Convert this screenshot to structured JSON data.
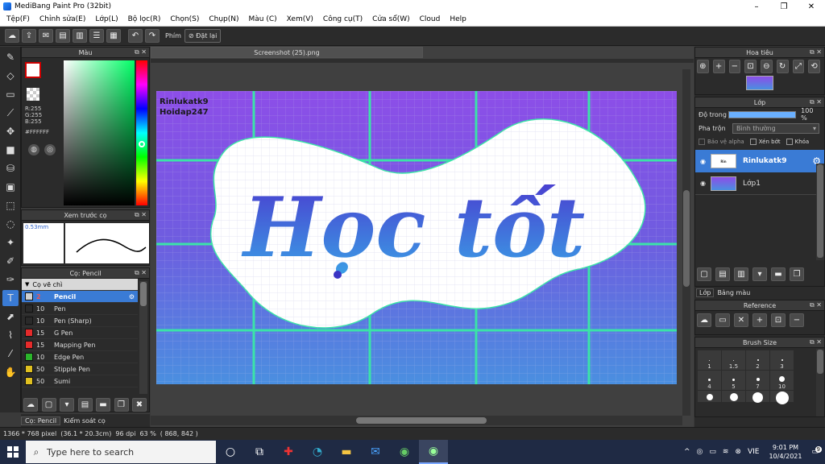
{
  "window": {
    "title": "MediBang Paint Pro (32bit)",
    "minimize": "–",
    "maximize": "❐",
    "close": "✕"
  },
  "menu": [
    "Tệp(F)",
    "Chỉnh sửa(E)",
    "Lớp(L)",
    "Bộ lọc(R)",
    "Chọn(S)",
    "Chụp(N)",
    "Màu (C)",
    "Xem(V)",
    "Công cụ(T)",
    "Cửa sổ(W)",
    "Cloud",
    "Help"
  ],
  "toolbar": {
    "finger_label": "Phím",
    "reset_label": "Đặt lại"
  },
  "color_panel": {
    "title": "Màu",
    "r": "R:255",
    "g": "G:255",
    "b": "B:255",
    "hex": "#FFFFFF"
  },
  "brush_preview": {
    "title": "Xem trước cọ",
    "size": "0.53mm"
  },
  "brush_panel": {
    "title": "Cọ: Pencil",
    "group": "Cọ vẽ chì",
    "items": [
      {
        "size": "2",
        "name": "Pencil",
        "color": "#cfcfcf",
        "selected": true
      },
      {
        "size": "10",
        "name": "Pen",
        "color": "#2a2a2a"
      },
      {
        "size": "10",
        "name": "Pen (Sharp)",
        "color": "#2a2a2a"
      },
      {
        "size": "15",
        "name": "G Pen",
        "color": "#e52b2b"
      },
      {
        "size": "15",
        "name": "Mapping Pen",
        "color": "#e52b2b"
      },
      {
        "size": "10",
        "name": "Edge Pen",
        "color": "#2bb52b"
      },
      {
        "size": "50",
        "name": "Stipple Pen",
        "color": "#e0c020"
      },
      {
        "size": "50",
        "name": "Sumi",
        "color": "#e0c020"
      }
    ]
  },
  "bottom_tabs": [
    "Cọ: Pencil",
    "Kiểm soát cọ"
  ],
  "document": {
    "tab": "Screenshot (25).png",
    "watermark_line1": "Rinlukatk9",
    "watermark_line2": "Hoidap247",
    "art_text": "Học tốt"
  },
  "navigator": {
    "title": "Hoa tiêu"
  },
  "layer_panel": {
    "title": "Lớp",
    "opacity_label": "Độ trong",
    "opacity_value": "100 %",
    "opacity": 1.0,
    "blend_label": "Pha trộn",
    "blend_value": "Bình thường",
    "protect_alpha": "Bảo vệ alpha",
    "clip": "Xén bớt",
    "lock": "Khóa",
    "layers": [
      {
        "name": "Rinlukatk9",
        "selected": true
      },
      {
        "name": "Lớp1",
        "selected": false
      }
    ],
    "tabs": [
      "Lớp",
      "Bảng màu"
    ]
  },
  "reference": {
    "title": "Reference"
  },
  "brush_size": {
    "title": "Brush Size",
    "sizes": [
      "1",
      "1.5",
      "2",
      "3",
      "4",
      "5",
      "7",
      "10"
    ]
  },
  "status": {
    "pixels": "1366 * 768 pixel",
    "cm": "(36.1 * 20.3cm)",
    "dpi": "96 dpi",
    "zoom": "63 %",
    "coords": "( 868, 842 )"
  },
  "taskbar": {
    "search_placeholder": "Type here to search",
    "lang": "VIE",
    "time": "9:01 PM",
    "date": "10/4/2021",
    "notifications": "9"
  }
}
